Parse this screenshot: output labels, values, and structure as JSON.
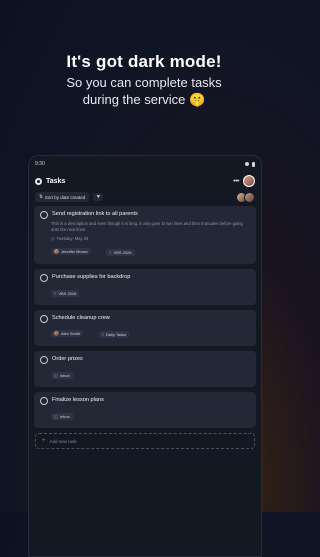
{
  "promo": {
    "headline": "It's got dark mode!",
    "subline1": "So you can complete tasks",
    "subline2": "during the service 🤫"
  },
  "device": {
    "status_time": "9:30",
    "app_title": "Tasks",
    "more_icon": "more-horizontal-icon",
    "sort_label": "Sort by date created",
    "filter_icon": "filter-icon"
  },
  "tasks": [
    {
      "title": "Send registration link to all parents",
      "description": "This is a description and even though it is long, it only goes to two lines and then truncates before going onto the next lines.",
      "date": "Tuesday, May 26",
      "assignee": "Jennifer Brown",
      "tag": "VBS 2026"
    },
    {
      "title": "Purchase supplies for backdrop",
      "tag": "VBS 2026"
    },
    {
      "title": "Schedule cleanup crew",
      "assignee": "Alex Smith",
      "tag": "Daily Tasks"
    },
    {
      "title": "Order prizes",
      "tag": "Inbox"
    },
    {
      "title": "Finalize lesson plans",
      "tag": "Inbox"
    }
  ],
  "add_task_placeholder": "Add new task",
  "colors": {
    "card": "#232836",
    "device_bg": "#141823",
    "page_bg": "#0f1525"
  }
}
